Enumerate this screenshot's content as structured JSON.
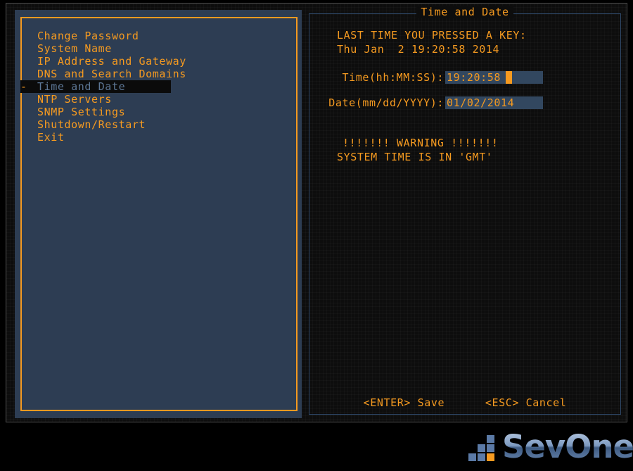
{
  "menu": {
    "items": [
      {
        "label": "Change Password",
        "selected": false,
        "marker": ""
      },
      {
        "label": "System Name",
        "selected": false,
        "marker": ""
      },
      {
        "label": "IP Address and Gateway",
        "selected": false,
        "marker": ""
      },
      {
        "label": "DNS and Search Domains",
        "selected": false,
        "marker": ""
      },
      {
        "label": "Time and Date",
        "selected": true,
        "marker": "-"
      },
      {
        "label": "NTP Servers",
        "selected": false,
        "marker": ""
      },
      {
        "label": "SNMP Settings",
        "selected": false,
        "marker": ""
      },
      {
        "label": "Shutdown/Restart",
        "selected": false,
        "marker": ""
      },
      {
        "label": "Exit",
        "selected": false,
        "marker": ""
      }
    ]
  },
  "detail": {
    "title": "Time and Date",
    "last_key_label": "LAST TIME YOU PRESSED A KEY:",
    "last_key_value": "Thu Jan  2 19:20:58 2014",
    "time_field": {
      "label": "Time(hh:MM:SS):",
      "value": "19:20:58"
    },
    "date_field": {
      "label": "Date(mm/dd/YYYY):",
      "value": "01/02/2014"
    },
    "warning_line": "!!!!!!! WARNING !!!!!!!",
    "gmt_line": "SYSTEM TIME IS IN 'GMT'",
    "actions": {
      "save": "<ENTER> Save",
      "cancel": "<ESC> Cancel"
    }
  },
  "branding": {
    "logo_text": "SevOne"
  },
  "colors": {
    "amber": "#f59a20",
    "panel_blue": "#2d3d53",
    "field_blue": "#32475f",
    "selected_text": "#5d7796",
    "detail_border": "#2f4868",
    "logo_blue": "#5b7aa6",
    "background": "#000000"
  }
}
